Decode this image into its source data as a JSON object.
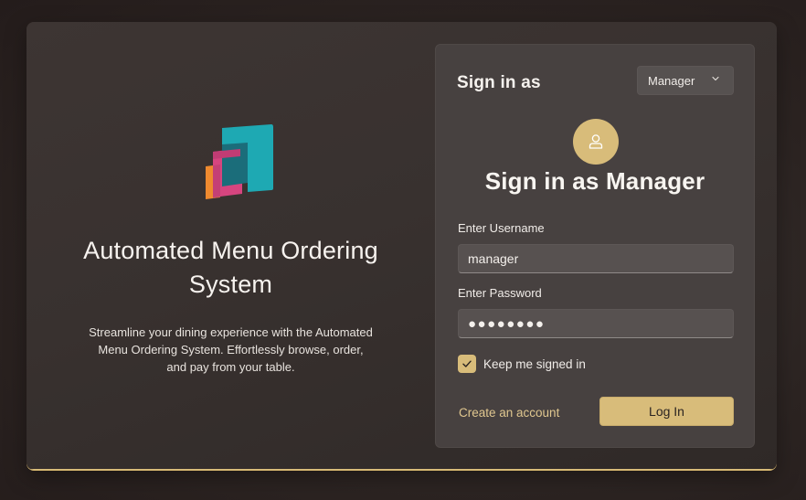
{
  "app": {
    "title": "Automated Menu Ordering System",
    "description": "Streamline your dining experience with the Automated Menu Ordering System. Effortlessly browse, order, and pay from your table."
  },
  "signin": {
    "section_label": "Sign in as",
    "role_select": {
      "selected": "Manager",
      "icon": "chevron-down-icon"
    },
    "avatar_icon": "user-icon",
    "heading": "Sign in as Manager",
    "username": {
      "label": "Enter Username",
      "value": "manager"
    },
    "password": {
      "label": "Enter Password",
      "value": "●●●●●●●●"
    },
    "keep_signed_in": {
      "label": "Keep me signed in",
      "checked": true
    },
    "create_account_link": "Create an account",
    "login_button": "Log In"
  },
  "colors": {
    "accent": "#d8bc7a",
    "link": "#e0c78f",
    "logo_teal": "#1ea9b3",
    "logo_pink": "#d6457f",
    "logo_orange": "#ef8a2f"
  }
}
